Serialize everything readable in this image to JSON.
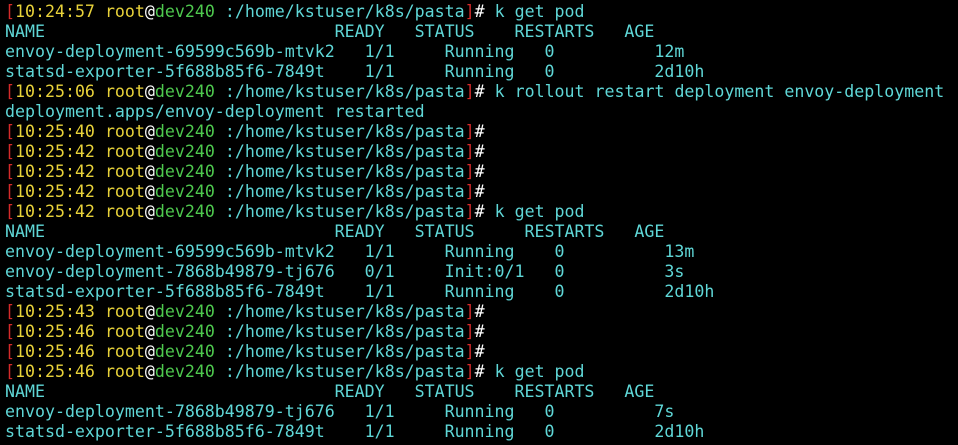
{
  "terminal": {
    "lines": [
      {
        "type": "prompt",
        "time": "10:24:57",
        "user": "root",
        "host": "dev240",
        "path": "/home/kstuser/k8s/pasta",
        "command": " k get pod"
      },
      {
        "type": "output",
        "text": "NAME                             READY   STATUS    RESTARTS   AGE"
      },
      {
        "type": "output",
        "text": "envoy-deployment-69599c569b-mtvk2   1/1     Running   0          12m"
      },
      {
        "type": "output",
        "text": "statsd-exporter-5f688b85f6-7849t    1/1     Running   0          2d10h"
      },
      {
        "type": "prompt",
        "time": "10:25:06",
        "user": "root",
        "host": "dev240",
        "path": "/home/kstuser/k8s/pasta",
        "command": " k rollout restart deployment envoy-deployment"
      },
      {
        "type": "output",
        "text": "deployment.apps/envoy-deployment restarted"
      },
      {
        "type": "prompt",
        "time": "10:25:40",
        "user": "root",
        "host": "dev240",
        "path": "/home/kstuser/k8s/pasta",
        "command": ""
      },
      {
        "type": "prompt",
        "time": "10:25:42",
        "user": "root",
        "host": "dev240",
        "path": "/home/kstuser/k8s/pasta",
        "command": ""
      },
      {
        "type": "prompt",
        "time": "10:25:42",
        "user": "root",
        "host": "dev240",
        "path": "/home/kstuser/k8s/pasta",
        "command": ""
      },
      {
        "type": "prompt",
        "time": "10:25:42",
        "user": "root",
        "host": "dev240",
        "path": "/home/kstuser/k8s/pasta",
        "command": ""
      },
      {
        "type": "prompt",
        "time": "10:25:42",
        "user": "root",
        "host": "dev240",
        "path": "/home/kstuser/k8s/pasta",
        "command": " k get pod"
      },
      {
        "type": "output",
        "text": "NAME                             READY   STATUS     RESTARTS   AGE"
      },
      {
        "type": "output",
        "text": "envoy-deployment-69599c569b-mtvk2   1/1     Running    0          13m"
      },
      {
        "type": "output",
        "text": "envoy-deployment-7868b49879-tj676   0/1     Init:0/1   0          3s"
      },
      {
        "type": "output",
        "text": "statsd-exporter-5f688b85f6-7849t    1/1     Running    0          2d10h"
      },
      {
        "type": "prompt",
        "time": "10:25:43",
        "user": "root",
        "host": "dev240",
        "path": "/home/kstuser/k8s/pasta",
        "command": ""
      },
      {
        "type": "prompt",
        "time": "10:25:46",
        "user": "root",
        "host": "dev240",
        "path": "/home/kstuser/k8s/pasta",
        "command": ""
      },
      {
        "type": "prompt",
        "time": "10:25:46",
        "user": "root",
        "host": "dev240",
        "path": "/home/kstuser/k8s/pasta",
        "command": ""
      },
      {
        "type": "prompt",
        "time": "10:25:46",
        "user": "root",
        "host": "dev240",
        "path": "/home/kstuser/k8s/pasta",
        "command": " k get pod"
      },
      {
        "type": "output",
        "text": "NAME                             READY   STATUS    RESTARTS   AGE"
      },
      {
        "type": "output",
        "text": "envoy-deployment-7868b49879-tj676   1/1     Running   0          7s"
      },
      {
        "type": "output",
        "text": "statsd-exporter-5f688b85f6-7849t    1/1     Running   0          2d10h"
      }
    ]
  },
  "colors": {
    "background": "#000000",
    "bracket": "#d42a2a",
    "time": "#e8d23a",
    "user": "#e8d23a",
    "host": "#4ec94e",
    "text": "#5fd7d7"
  }
}
